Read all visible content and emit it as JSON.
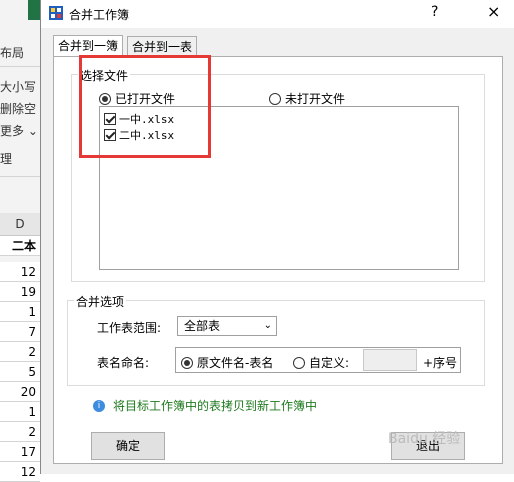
{
  "excel": {
    "ribbon_lines": [
      "布局",
      "大小写",
      "删除空",
      "更多 ⌄",
      "理"
    ],
    "column_header": "D",
    "header_cell": "二本",
    "cells": [
      "12",
      "19",
      "1",
      "7",
      "2",
      "5",
      "20",
      "1",
      "2",
      "17",
      "12"
    ]
  },
  "dialog": {
    "title": "合并工作簿",
    "help": "?",
    "close": "×",
    "tabs": [
      "合并到一簿",
      "合并到一表"
    ],
    "select_files": {
      "label": "选择文件",
      "opened_label": "已打开文件",
      "unopened_label": "未打开文件",
      "files": [
        "一中.xlsx",
        "二中.xlsx"
      ]
    },
    "merge_options": {
      "label": "合并选项",
      "range_label": "工作表范围:",
      "range_value": "全部表",
      "naming_label": "表名命名:",
      "naming_opt1": "原文件名-表名",
      "naming_opt2": "自定义:",
      "suffix": "+序号"
    },
    "info_text": "将目标工作簿中的表拷贝到新工作簿中",
    "ok_label": "确定",
    "exit_label": "退出",
    "watermark": "Baidu 经验"
  }
}
